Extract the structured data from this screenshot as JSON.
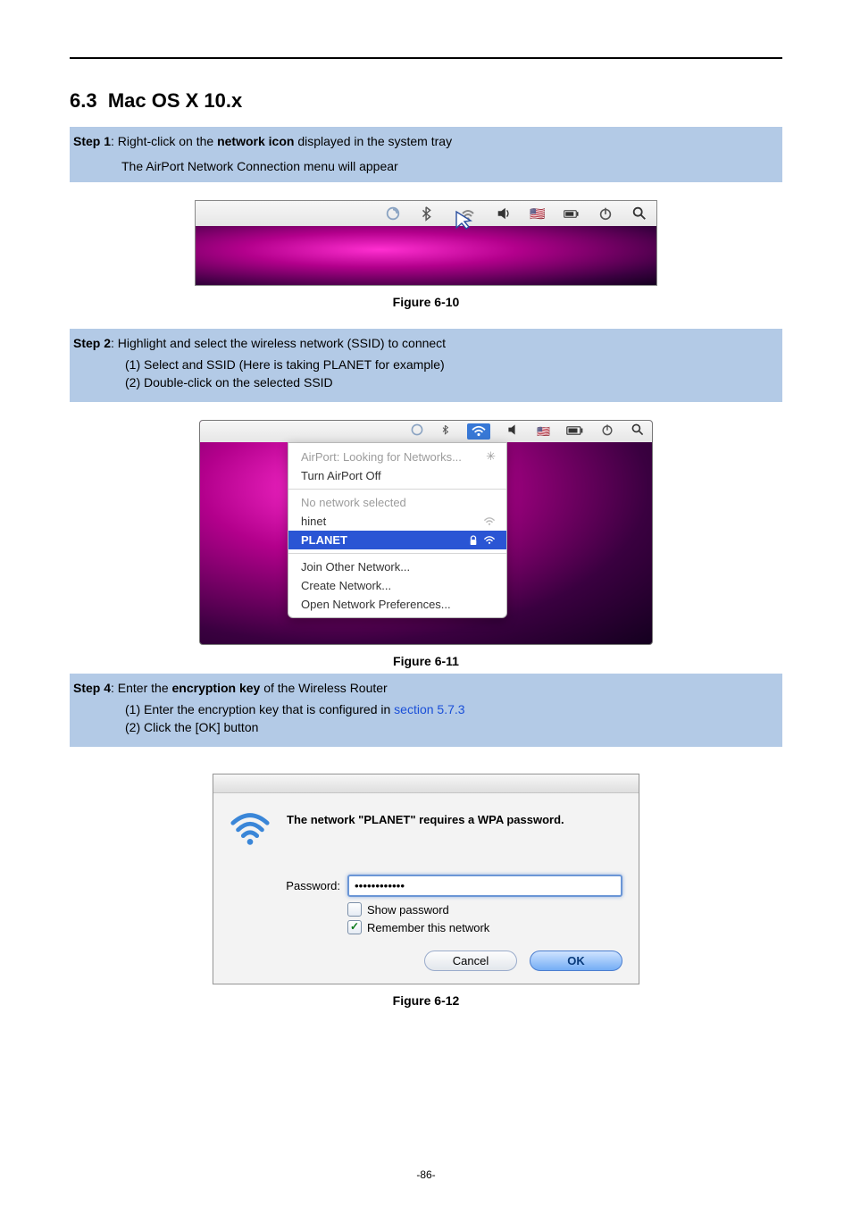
{
  "section": {
    "number": "6.3",
    "title": "Mac OS X 10.x"
  },
  "step1": {
    "label": "Step 1",
    "text_prefix": ": Right-click on the ",
    "bold": "network icon",
    "text_suffix": " displayed in the system tray",
    "sub": "The AirPort Network Connection menu will appear"
  },
  "figure1_label": "Figure 6-10",
  "step2": {
    "label": "Step 2",
    "text": ": Highlight and select the wireless network (SSID) to connect",
    "item1": "(1)  Select and SSID (Here is taking PLANET for example)",
    "item2": "(2)  Double-click on the selected SSID"
  },
  "dropdown": {
    "looking": "AirPort: Looking for Networks...",
    "turn_off": "Turn AirPort Off",
    "no_net": "No network selected",
    "hinet": "hinet",
    "planet": "PLANET",
    "join_other": "Join Other Network...",
    "create": "Create Network...",
    "prefs": "Open Network Preferences..."
  },
  "figure2_label": "Figure 6-11",
  "step4": {
    "label": "Step 4",
    "text_prefix": ": Enter the ",
    "bold": "encryption key",
    "text_suffix": " of the Wireless Router",
    "item1a": "(1)  Enter the encryption key that is configured in ",
    "item1_link": "section 5.7.3",
    "item2": "(2)  Click the [OK] button"
  },
  "dialog": {
    "message": "The network \"PLANET\" requires a WPA password.",
    "password_label": "Password:",
    "password_value": "••••••••••••",
    "show_password": "Show password",
    "remember": "Remember this network",
    "cancel": "Cancel",
    "ok": "OK"
  },
  "figure3_label": "Figure 6-12",
  "page_number": "-86-"
}
